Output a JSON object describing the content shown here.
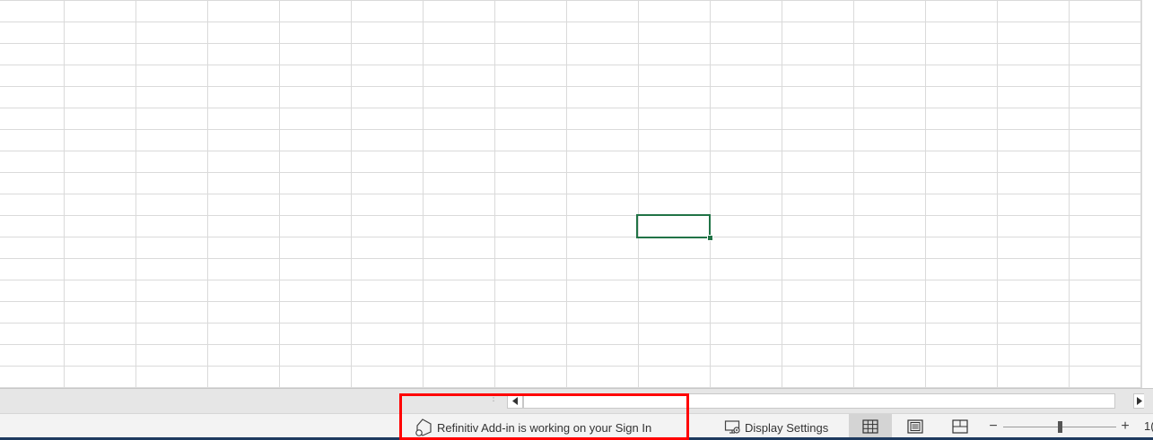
{
  "statusbar": {
    "addin_status": "Refinitiv Add-in is working on your Sign In",
    "addin_icon": "refinitiv-addin-icon",
    "display_settings_label": "Display Settings",
    "display_settings_icon": "display-settings-icon",
    "views": [
      {
        "name": "normal-view",
        "icon": "grid-icon",
        "active": true
      },
      {
        "name": "page-layout-view",
        "icon": "page-layout-icon",
        "active": false
      },
      {
        "name": "page-break-preview",
        "icon": "page-break-icon",
        "active": false
      }
    ],
    "zoom_minus": "−",
    "zoom_plus": "+",
    "zoom_level_partial": "1("
  },
  "colors": {
    "active_cell_border": "#217346",
    "highlight": "#ff0000",
    "gridline": "#dadada"
  }
}
